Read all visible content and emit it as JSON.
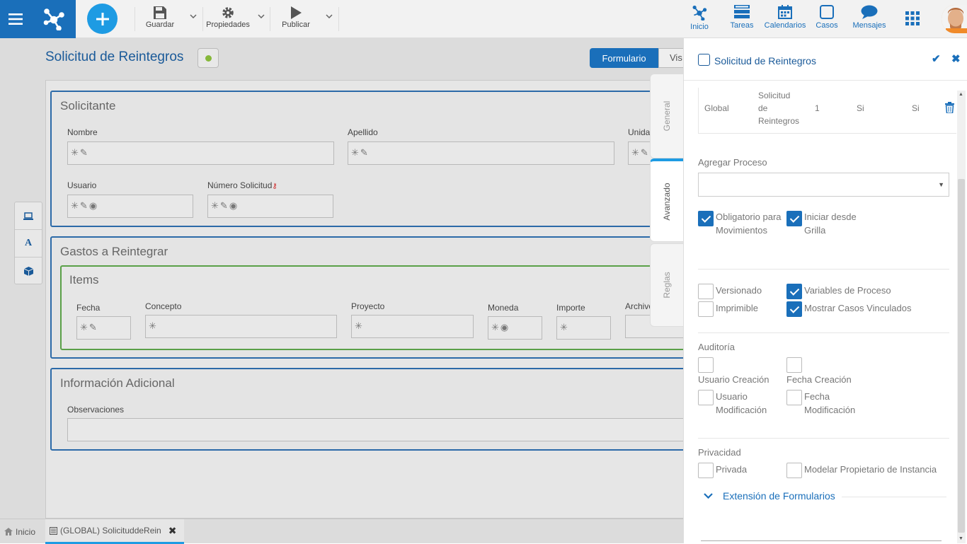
{
  "toolbar": {
    "guardar": "Guardar",
    "propiedades": "Propiedades",
    "publicar": "Publicar"
  },
  "topnav": {
    "inicio": "Inicio",
    "tareas": "Tareas",
    "calendarios": "Calendarios",
    "casos": "Casos",
    "mensajes": "Mensajes"
  },
  "page": {
    "title": "Solicitud de Reintegros",
    "view_tabs": [
      "Formulario",
      "Vis"
    ]
  },
  "form": {
    "solicitante": {
      "title": "Solicitante",
      "nombre": "Nombre",
      "apellido": "Apellido",
      "unidad": "Unida",
      "usuario": "Usuario",
      "numero": "Número Solicitud"
    },
    "gastos": {
      "title": "Gastos a Reintegrar",
      "items_title": "Items",
      "fecha": "Fecha",
      "concepto": "Concepto",
      "proyecto": "Proyecto",
      "moneda": "Moneda",
      "importe": "Importe",
      "archivo": "Archivo"
    },
    "info": {
      "title": "Información Adicional",
      "observaciones": "Observaciones"
    }
  },
  "left_tools": [
    "laptop-icon",
    "font-icon",
    "cube-icon"
  ],
  "bottom_tabs": {
    "inicio": "Inicio",
    "doc": "(GLOBAL) SolicituddeRein"
  },
  "side_tabs": {
    "general": "General",
    "avanzado": "Avanzado",
    "reglas": "Reglas"
  },
  "panel": {
    "title": "Solicitud de Reintegros",
    "process_row": {
      "scope": "Global",
      "name_l1": "Solicitud",
      "name_l2": "de",
      "name_l3": "Reintegros",
      "version": "1",
      "col4": "Si",
      "col5": "Si"
    },
    "agregar_proceso": "Agregar Proceso",
    "oblig_l1": "Obligatorio para",
    "oblig_l2": "Movimientos",
    "iniciar_l1": "Iniciar desde",
    "iniciar_l2": "Grilla",
    "versionado": "Versionado",
    "variables": "Variables de Proceso",
    "imprimible": "Imprimible",
    "mostrar": "Mostrar Casos Vinculados",
    "auditoria": "Auditoría",
    "usuario_creacion": "Usuario Creación",
    "fecha_creacion": "Fecha Creación",
    "usuario_mod_l1": "Usuario",
    "usuario_mod_l2": "Modificación",
    "fecha_mod_l1": "Fecha",
    "fecha_mod_l2": "Modificación",
    "privacidad": "Privacidad",
    "privada": "Privada",
    "modelar": "Modelar Propietario de Instancia",
    "extension": "Extensión de Formularios"
  },
  "checks": {
    "obligatorio": true,
    "iniciar": true,
    "versionado": false,
    "variables": true,
    "imprimible": false,
    "mostrar": true,
    "usuario_creacion": false,
    "fecha_creacion": false,
    "usuario_mod": false,
    "fecha_mod": false,
    "privada": false,
    "modelar": false
  },
  "colors": {
    "brand": "#1a6fba",
    "section_border": "#2c6aa8",
    "grid_border": "#5aa048",
    "status_dot": "#86b83a"
  }
}
